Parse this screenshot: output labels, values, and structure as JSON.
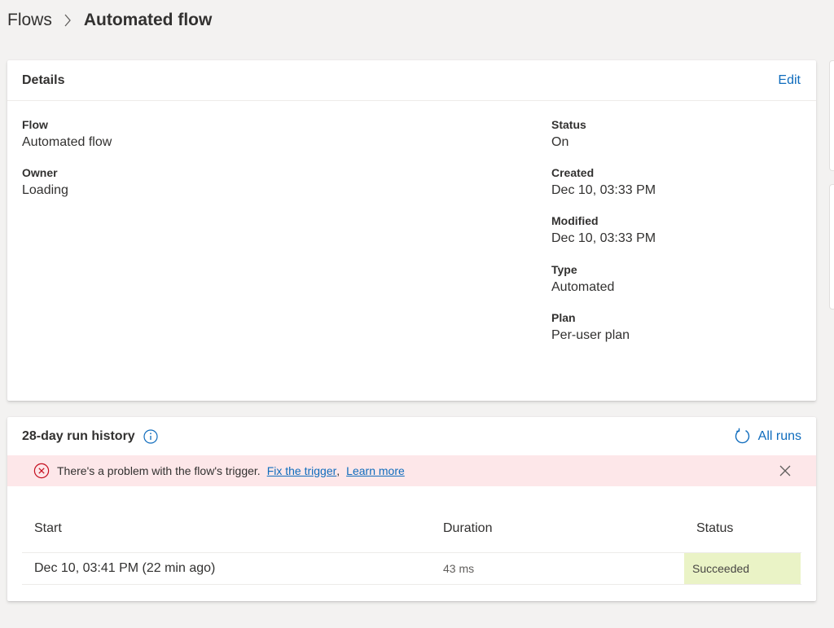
{
  "breadcrumb": {
    "root": "Flows",
    "current": "Automated flow"
  },
  "details": {
    "title": "Details",
    "edit_label": "Edit",
    "fields": {
      "flow": {
        "label": "Flow",
        "value": "Automated flow"
      },
      "owner": {
        "label": "Owner",
        "value": "Loading"
      },
      "status": {
        "label": "Status",
        "value": "On"
      },
      "created": {
        "label": "Created",
        "value": "Dec 10, 03:33 PM"
      },
      "modified": {
        "label": "Modified",
        "value": "Dec 10, 03:33 PM"
      },
      "type": {
        "label": "Type",
        "value": "Automated"
      },
      "plan": {
        "label": "Plan",
        "value": "Per-user plan"
      }
    }
  },
  "run_history": {
    "title": "28-day run history",
    "all_runs_label": "All runs",
    "error": {
      "message": "There's a problem with the flow's trigger.",
      "fix_link": "Fix the trigger",
      "learn_link": "Learn more"
    },
    "columns": [
      "Start",
      "Duration",
      "Status"
    ],
    "rows": [
      {
        "start": "Dec 10, 03:41 PM (22 min ago)",
        "duration": "43 ms",
        "status": "Succeeded"
      }
    ]
  },
  "icons": {
    "breadcrumb_separator": "chevron-right-icon",
    "info": "info-icon",
    "refresh": "refresh-icon",
    "error": "error-circle-icon",
    "dismiss": "close-icon"
  },
  "colors": {
    "accent": "#0f6cbd",
    "error_bg": "#fde7e9",
    "error_icon": "#c50f1f",
    "success_bg": "#eaf3c6",
    "page_bg": "#f3f2f1"
  }
}
